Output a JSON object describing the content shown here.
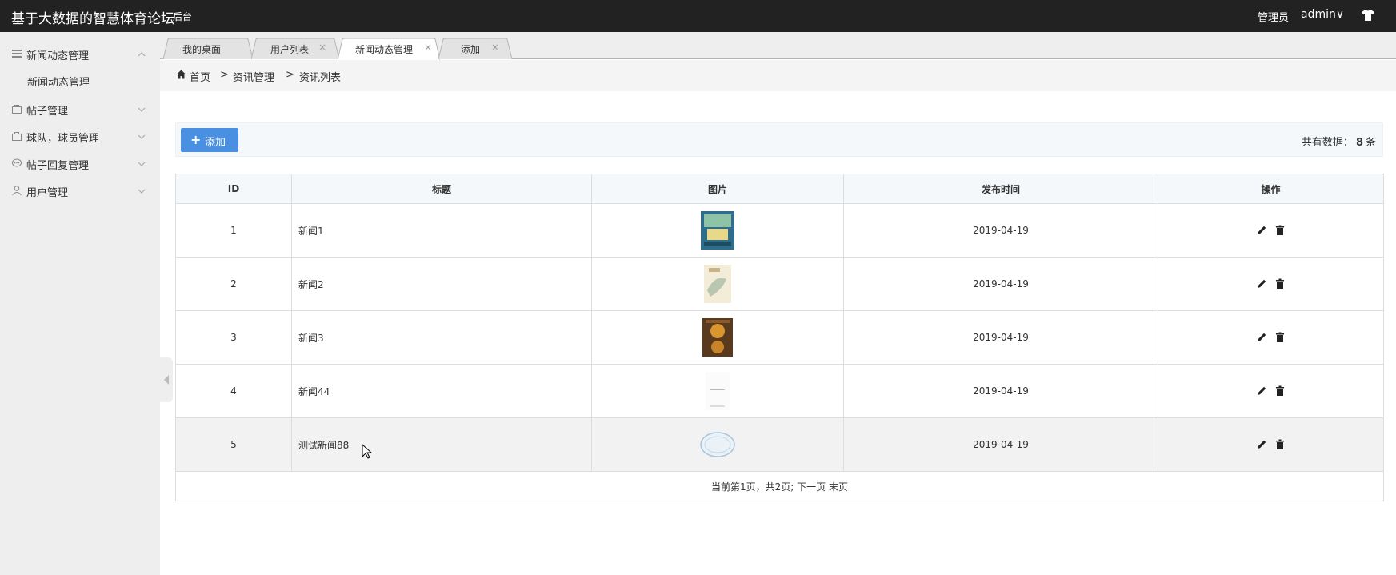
{
  "topbar": {
    "title": "基于大数据的智慧体育论坛",
    "subtitle": "后台",
    "role": "管理员",
    "user": "admin∨"
  },
  "sidebar": {
    "items": [
      {
        "label": "新闻动态管理",
        "icon": "list-icon",
        "expanded": true
      },
      {
        "label": "帖子管理",
        "icon": "bag-icon",
        "expanded": false
      },
      {
        "label": "球队，球员管理",
        "icon": "bag-icon",
        "expanded": false
      },
      {
        "label": "帖子回复管理",
        "icon": "comment-icon",
        "expanded": false
      },
      {
        "label": "用户管理",
        "icon": "user-icon",
        "expanded": false
      }
    ],
    "subitems": [
      {
        "label": "新闻动态管理"
      }
    ]
  },
  "tabs": [
    {
      "label": "我的桌面",
      "closable": false,
      "active": false
    },
    {
      "label": "用户列表",
      "closable": true,
      "active": false
    },
    {
      "label": "新闻动态管理",
      "closable": true,
      "active": true
    },
    {
      "label": "添加",
      "closable": true,
      "active": false
    }
  ],
  "breadcrumb": {
    "home": "首页",
    "sep": ">",
    "level1": "资讯管理",
    "level2": "资讯列表"
  },
  "toolbar": {
    "plus": "+",
    "add_label": "添加",
    "total_prefix": "共有数据：",
    "total_count": "8",
    "total_suffix": "条"
  },
  "table": {
    "columns": [
      "ID",
      "标题",
      "图片",
      "发布时间",
      "操作"
    ],
    "rows": [
      {
        "id": "1",
        "title": "新闻1",
        "date": "2019-04-19",
        "thumb": "book-cover-blue"
      },
      {
        "id": "2",
        "title": "新闻2",
        "date": "2019-04-19",
        "thumb": "book-cover-cream"
      },
      {
        "id": "3",
        "title": "新闻3",
        "date": "2019-04-19",
        "thumb": "book-cover-brown"
      },
      {
        "id": "4",
        "title": "新闻44",
        "date": "2019-04-19",
        "thumb": "book-cover-white"
      },
      {
        "id": "5",
        "title": "测试新闻88",
        "date": "2019-04-19",
        "thumb": "stamp-logo"
      }
    ],
    "thumb_text": {
      "row4": "认知天性",
      "row5": "暂无图片"
    },
    "pager": {
      "current": "当前第1页，共2页;",
      "next": "下一页",
      "last": "末页"
    }
  },
  "colors": {
    "topbar": "#222222",
    "sidebar": "#eeeeee",
    "accent": "#4a90e2",
    "border": "#dddddd"
  }
}
